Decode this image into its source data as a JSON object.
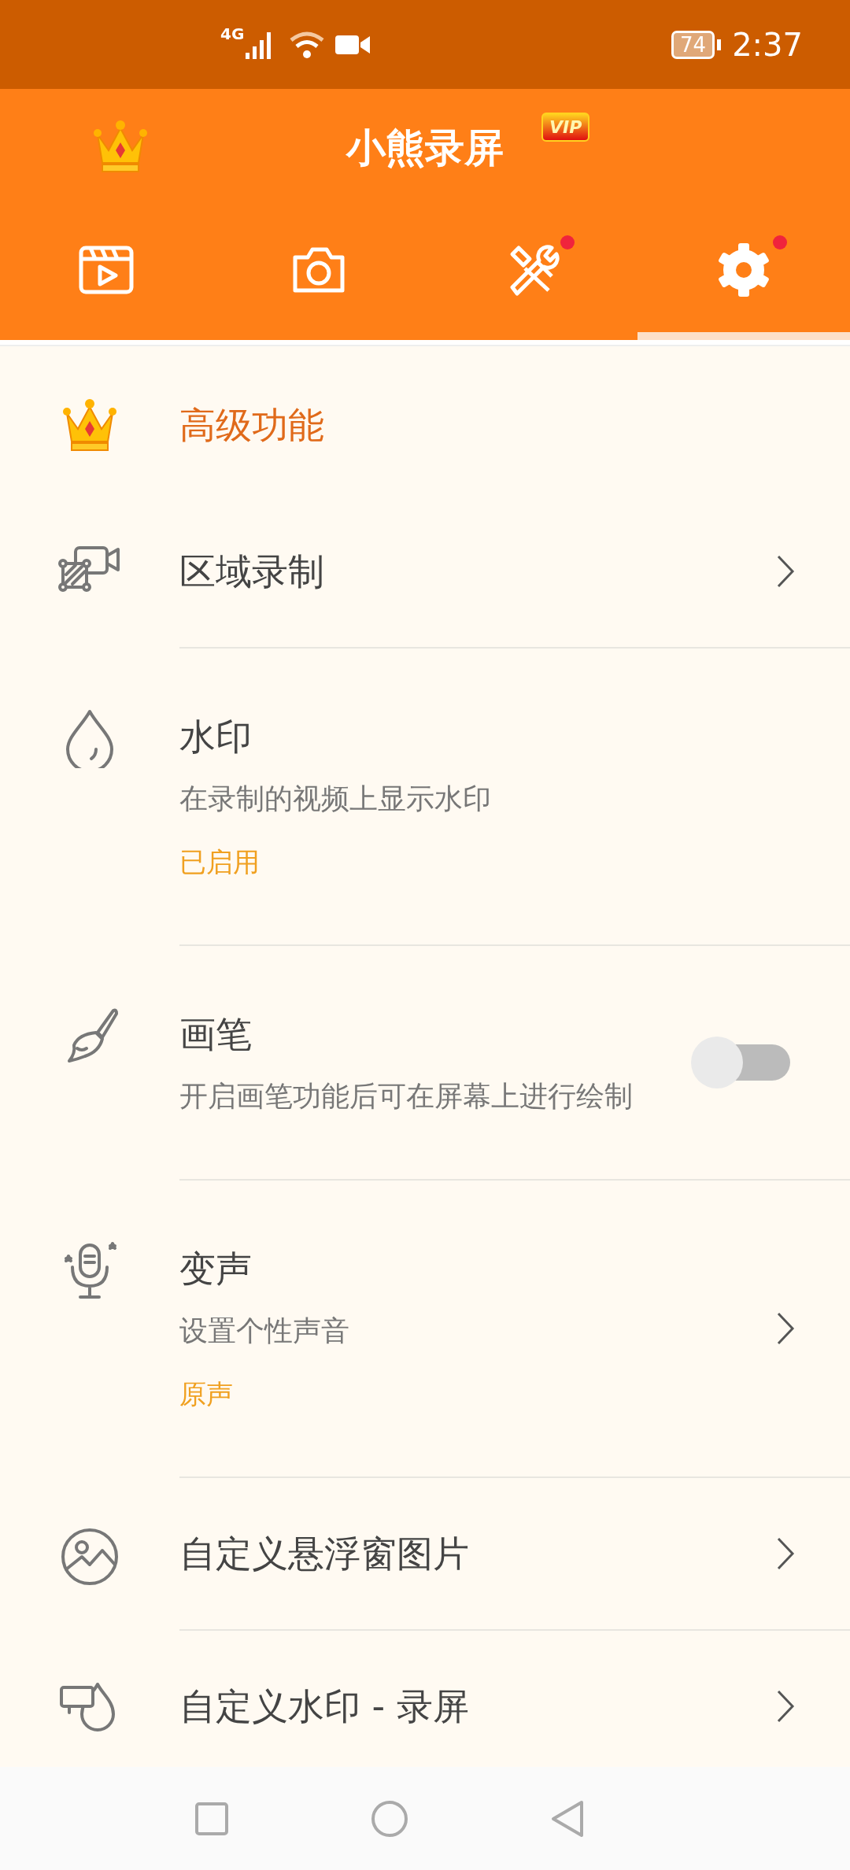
{
  "status_bar": {
    "network": "4G",
    "battery": "74",
    "time": "2:37"
  },
  "header": {
    "title": "小熊录屏",
    "badge": "VIP"
  },
  "tabs": [
    {
      "kind": "video",
      "selected": false,
      "dot": false
    },
    {
      "kind": "camera",
      "selected": false,
      "dot": false
    },
    {
      "kind": "tools",
      "selected": false,
      "dot": true
    },
    {
      "kind": "settings",
      "selected": true,
      "dot": true
    }
  ],
  "section": {
    "title": "高级功能"
  },
  "items": [
    {
      "kind": "link",
      "title": "区域录制"
    },
    {
      "kind": "info",
      "title": "水印",
      "subtitle": "在录制的视频上显示水印",
      "status": "已启用"
    },
    {
      "kind": "toggle",
      "title": "画笔",
      "subtitle": "开启画笔功能后可在屏幕上进行绘制",
      "on": false
    },
    {
      "kind": "link",
      "title": "变声",
      "subtitle": "设置个性声音",
      "status": "原声"
    },
    {
      "kind": "link",
      "title": "自定义悬浮窗图片"
    },
    {
      "kind": "link",
      "title": "自定义水印 - 录屏"
    }
  ]
}
